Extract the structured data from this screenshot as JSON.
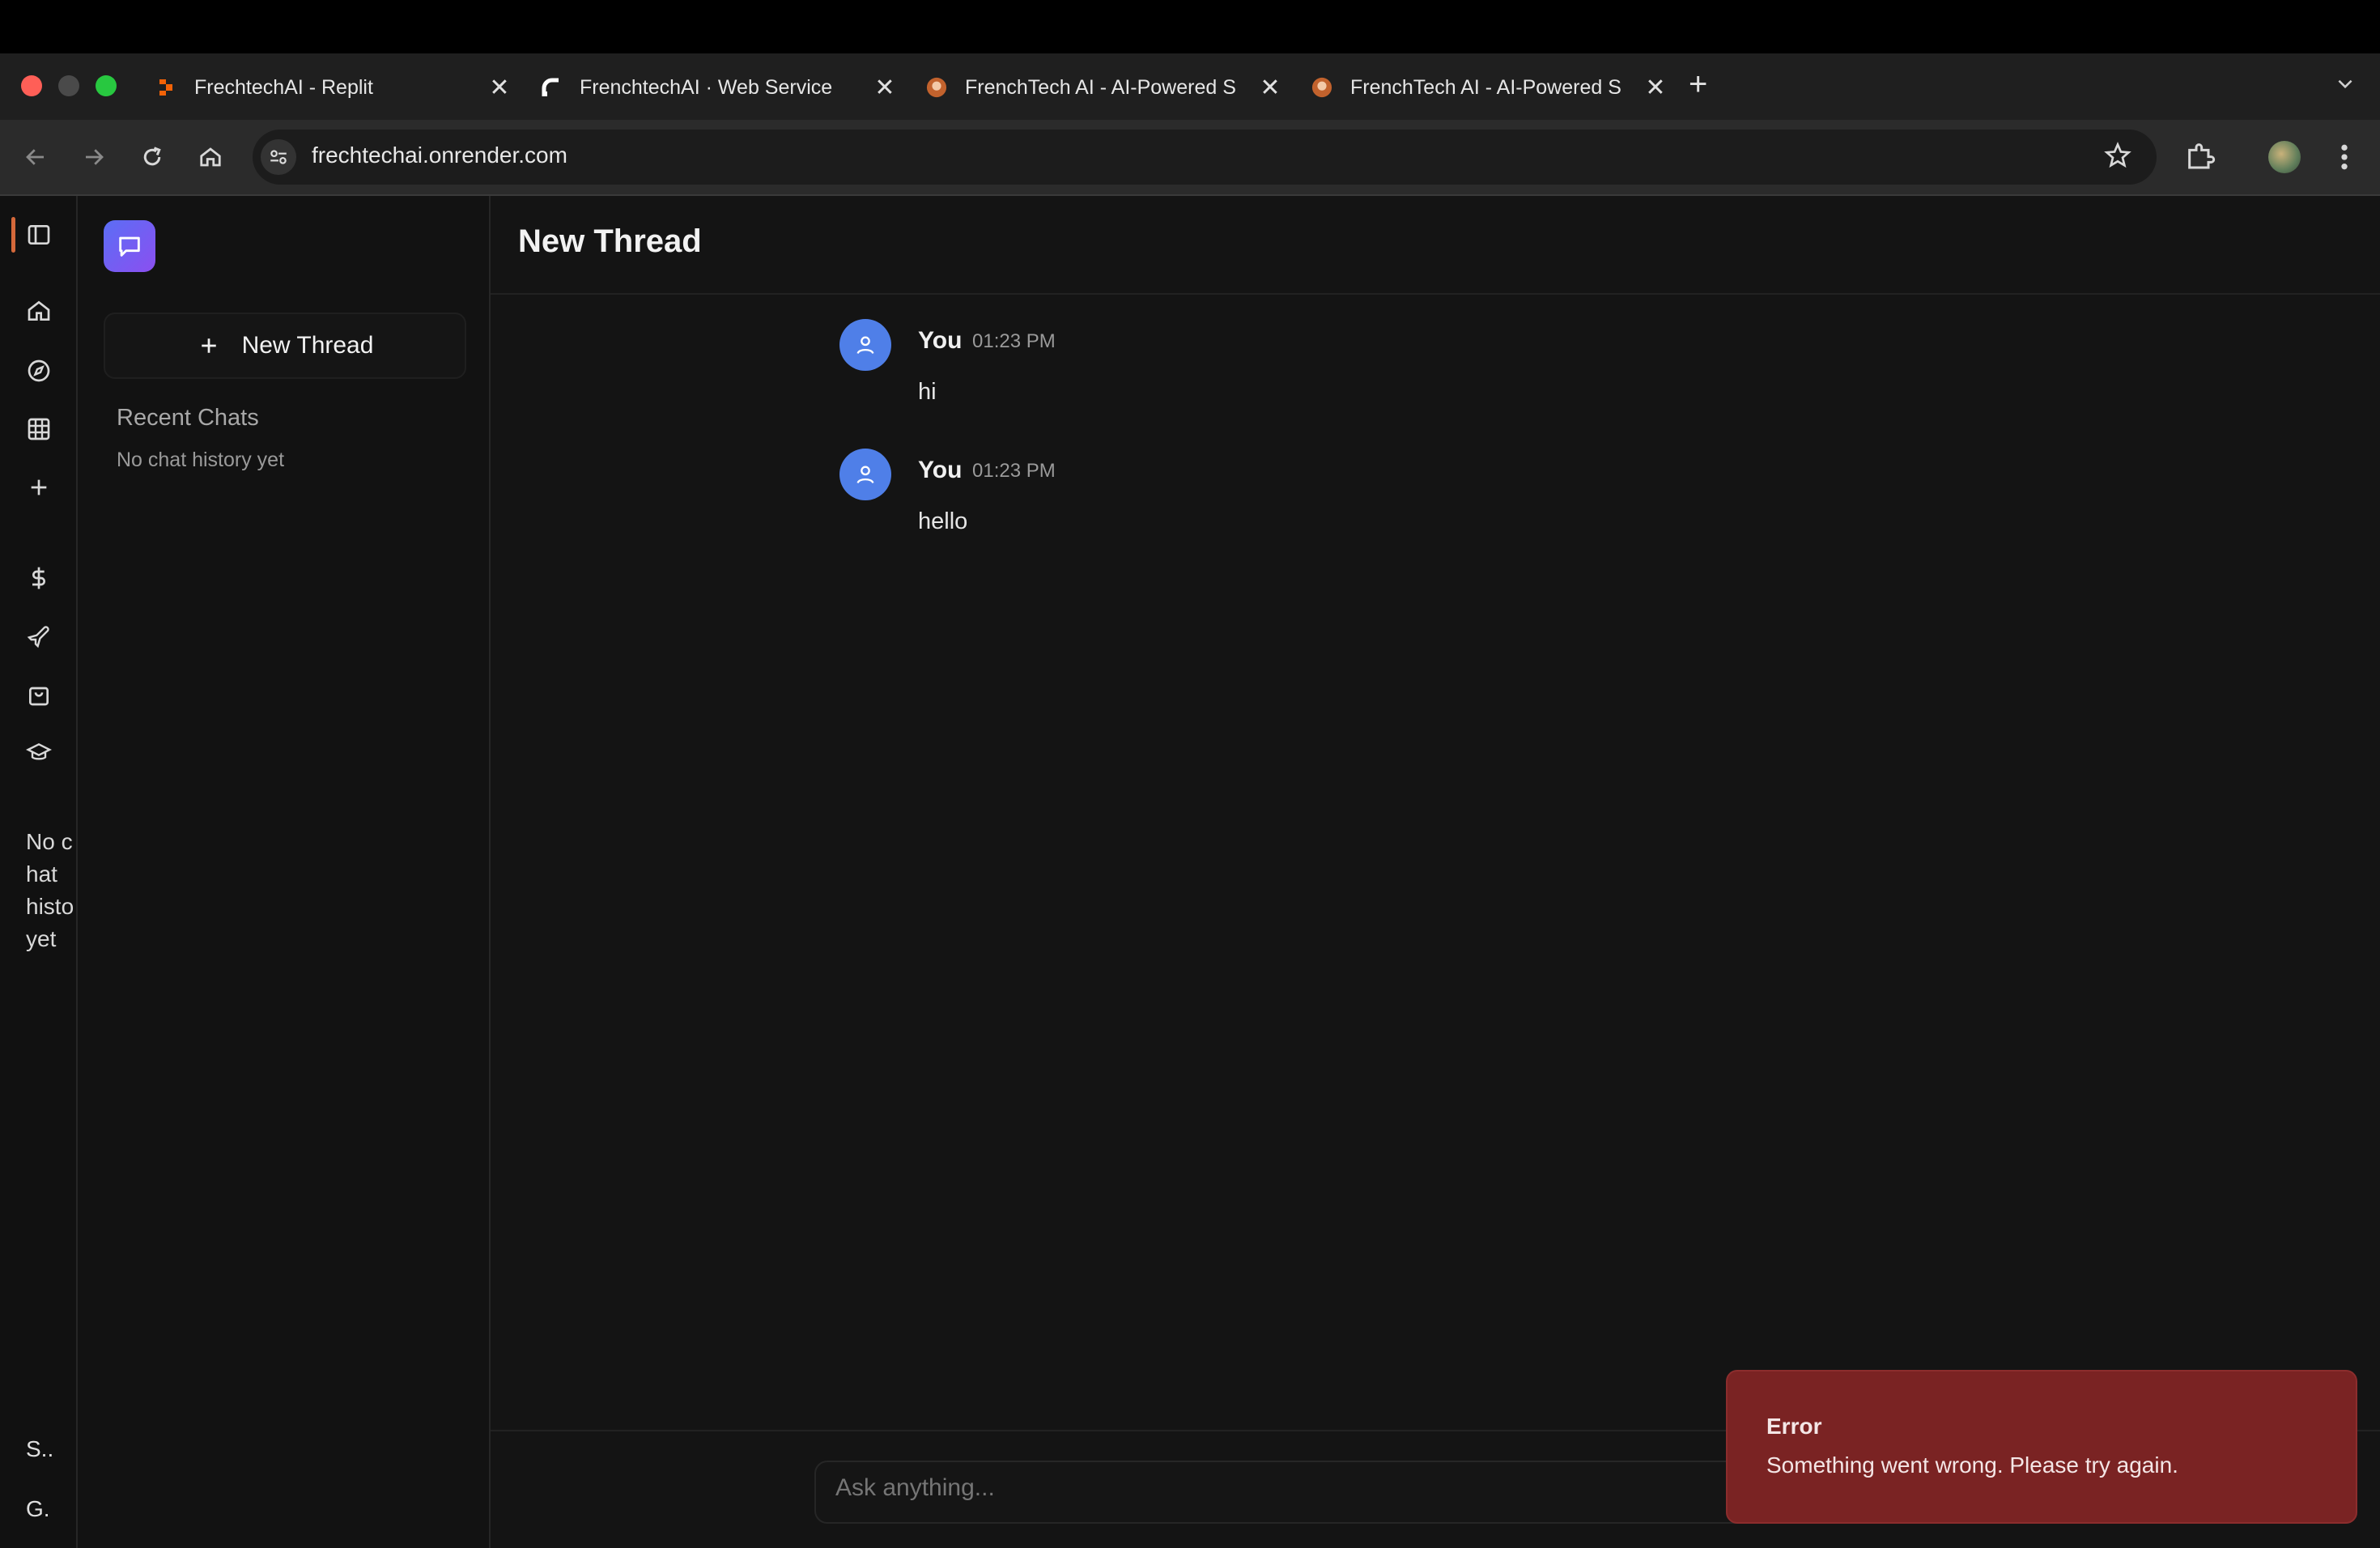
{
  "browser": {
    "tabs": [
      {
        "title": "FrechtechAI - Replit",
        "icon": "replit-icon"
      },
      {
        "title": "FrenchtechAI · Web Service",
        "icon": "render-icon"
      },
      {
        "title": "FrenchTech AI - AI-Powered S",
        "icon": "frenchtech-icon"
      },
      {
        "title": "FrenchTech AI - AI-Powered S",
        "icon": "frenchtech-icon"
      }
    ],
    "close_glyph": "✕",
    "new_tab_glyph": "+",
    "url": "frechtechai.onrender.com"
  },
  "rail": {
    "icons": [
      "sidebar-toggle-icon",
      "home-icon",
      "compass-icon",
      "grid-icon",
      "plus-icon",
      "dollar-icon",
      "plane-icon",
      "shopping-bag-icon",
      "graduation-cap-icon"
    ],
    "no_history_text": "No chat histo yet",
    "bottom_items": [
      "S..",
      "G."
    ]
  },
  "sidebar": {
    "new_thread_label": "New Thread",
    "recent_title": "Recent Chats",
    "no_history": "No chat history yet"
  },
  "main": {
    "title": "New Thread",
    "messages": [
      {
        "author": "You",
        "time": "01:23 PM",
        "text": "hi"
      },
      {
        "author": "You",
        "time": "01:23 PM",
        "text": "hello"
      }
    ],
    "composer_placeholder": "Ask anything..."
  },
  "toast": {
    "title": "Error",
    "message": "Something went wrong. Please try again."
  },
  "colors": {
    "background": "#141414",
    "accent": "#4f7fe8",
    "error": "#7a2323",
    "logo_gradient": [
      "#5b6ef5",
      "#8b4ff0"
    ]
  }
}
